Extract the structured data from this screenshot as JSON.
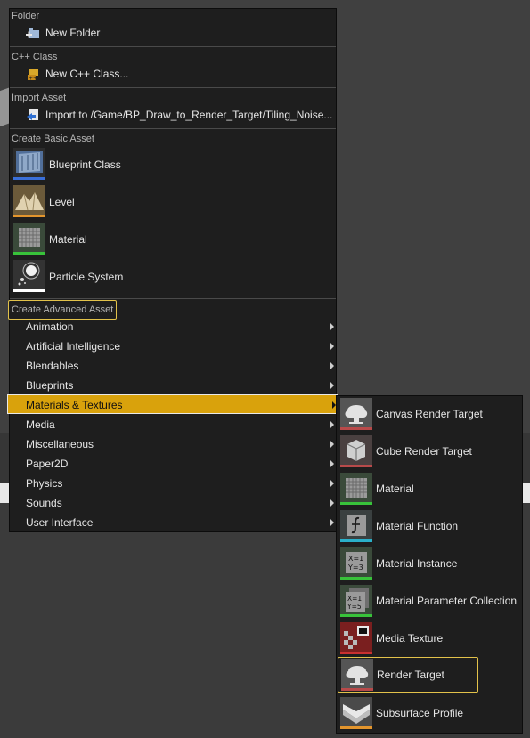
{
  "menu": {
    "folder": {
      "header": "Folder",
      "new_folder": "New Folder"
    },
    "cpp": {
      "header": "C++ Class",
      "new_cpp": "New C++ Class..."
    },
    "import": {
      "header": "Import Asset",
      "import_to": "Import to /Game/BP_Draw_to_Render_Target/Tiling_Noise..."
    },
    "basic": {
      "header": "Create Basic Asset",
      "items": [
        {
          "label": "Blueprint Class",
          "icon": "blueprint-class-icon",
          "color": "#3a6fd8"
        },
        {
          "label": "Level",
          "icon": "level-icon",
          "color": "#e3952d"
        },
        {
          "label": "Material",
          "icon": "material-icon",
          "color": "#38c23a"
        },
        {
          "label": "Particle System",
          "icon": "particle-system-icon",
          "color": "#ffffff"
        }
      ]
    },
    "advanced": {
      "header": "Create Advanced Asset",
      "items": [
        {
          "label": "Animation"
        },
        {
          "label": "Artificial Intelligence"
        },
        {
          "label": "Blendables"
        },
        {
          "label": "Blueprints"
        },
        {
          "label": "Materials & Textures"
        },
        {
          "label": "Media"
        },
        {
          "label": "Miscellaneous"
        },
        {
          "label": "Paper2D"
        },
        {
          "label": "Physics"
        },
        {
          "label": "Sounds"
        },
        {
          "label": "User Interface"
        }
      ],
      "active_item": "Materials & Textures"
    }
  },
  "submenu": {
    "items": [
      {
        "label": "Canvas Render Target",
        "icon": "canvas-render-target-icon",
        "color": "#b84a4a"
      },
      {
        "label": "Cube Render Target",
        "icon": "cube-render-target-icon",
        "color": "#b84a4a"
      },
      {
        "label": "Material",
        "icon": "material-icon",
        "color": "#38c23a"
      },
      {
        "label": "Material Function",
        "icon": "material-function-icon",
        "color": "#2ab0c9"
      },
      {
        "label": "Material Instance",
        "icon": "material-instance-icon",
        "color": "#38c23a"
      },
      {
        "label": "Material Parameter Collection",
        "icon": "material-parameter-collection-icon",
        "color": "#38c23a"
      },
      {
        "label": "Media Texture",
        "icon": "media-texture-icon",
        "color": "#c93030"
      },
      {
        "label": "Render Target",
        "icon": "render-target-icon",
        "color": "#b84a4a"
      },
      {
        "label": "Subsurface Profile",
        "icon": "subsurface-profile-icon",
        "color": "#e3952d"
      }
    ],
    "hovered_item": "Render Target"
  },
  "colors": {
    "accent": "#d9a20c",
    "highlight_border": "#e2c24a",
    "menu_bg": "#1e1e1e"
  }
}
